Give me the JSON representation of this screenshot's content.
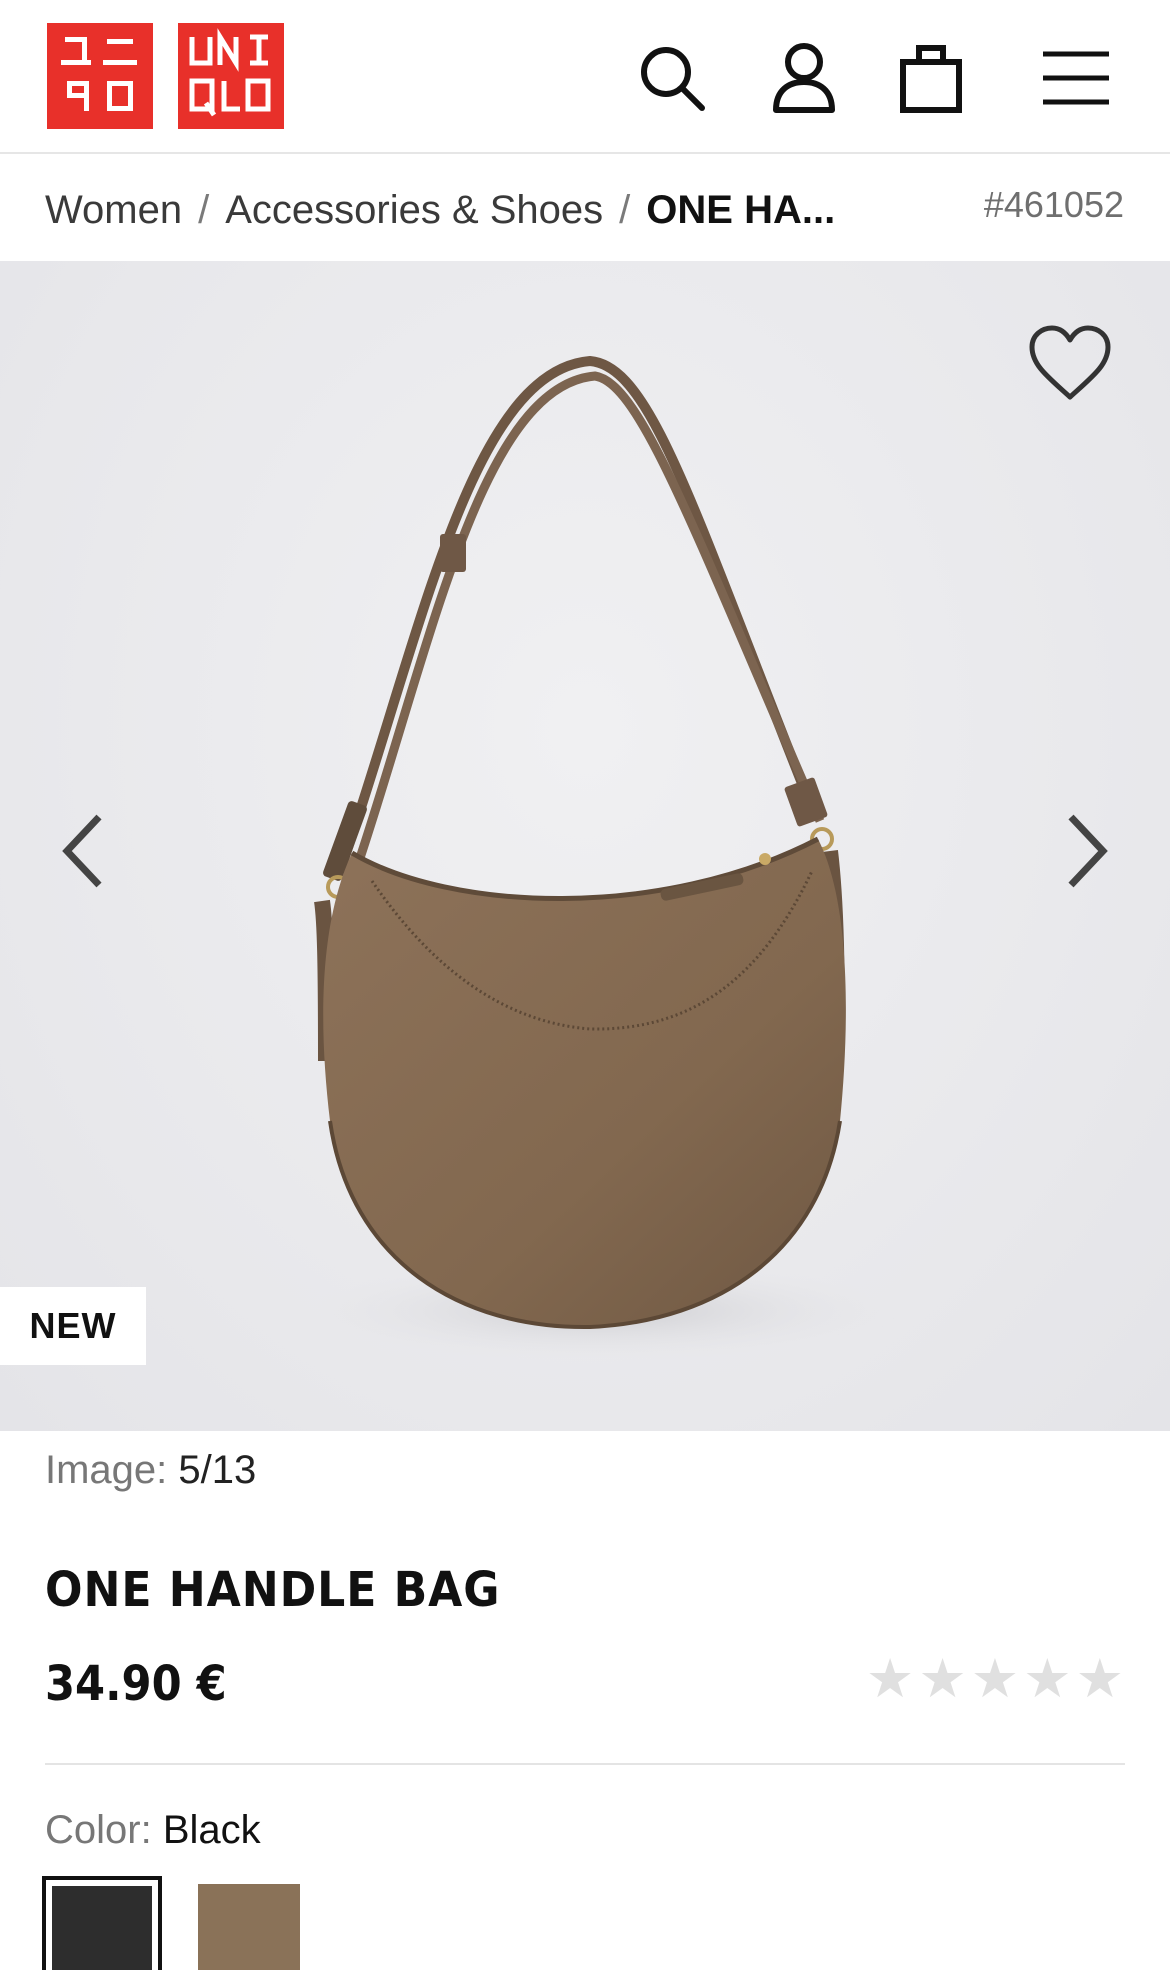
{
  "header": {
    "logo_left_text": "ユニクロ",
    "logo_right_text": "UNIQLO",
    "brand_color": "#e8302a",
    "icons": [
      "search-icon",
      "account-icon",
      "cart-icon",
      "menu-icon"
    ]
  },
  "breadcrumb": {
    "items": [
      "Women",
      "Accessories & Shoes",
      "ONE HA..."
    ],
    "separator": "/"
  },
  "product_code": "#461052",
  "gallery": {
    "badge": "NEW",
    "counter_label": "Image:",
    "counter_value": "5/13"
  },
  "product": {
    "title": "ONE HANDLE BAG",
    "price": "34.90 €",
    "rating_stars": 5,
    "rating_value": 0
  },
  "color": {
    "label": "Color:",
    "selected": "Black",
    "swatches": [
      {
        "name": "Black",
        "hex": "#2d2d2d"
      },
      {
        "name": "Brown",
        "hex": "#8a7258"
      }
    ]
  }
}
